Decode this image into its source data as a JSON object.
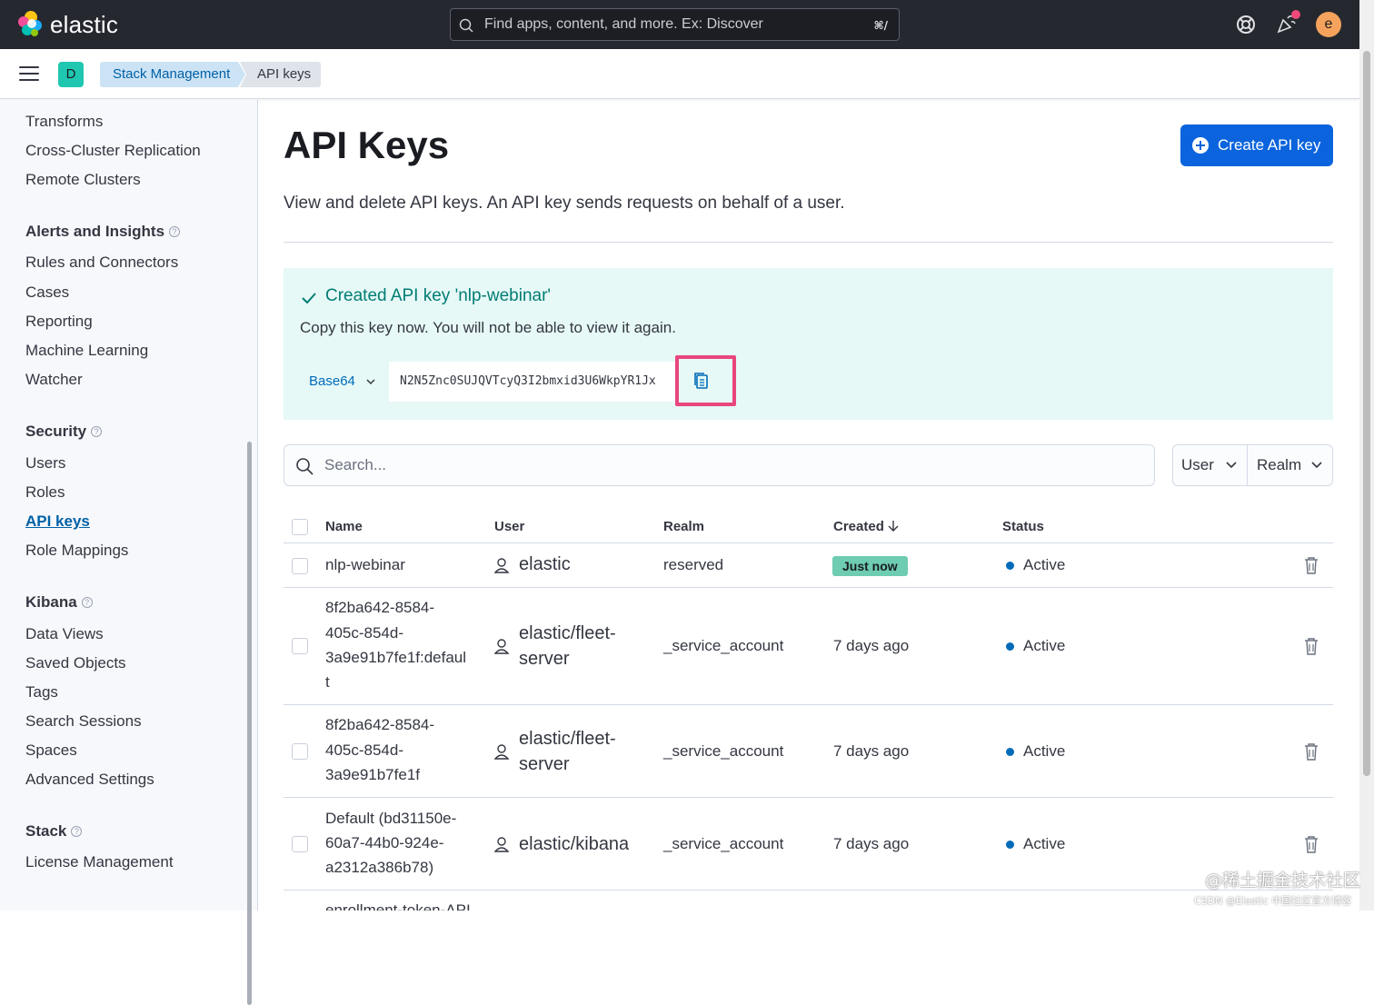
{
  "header": {
    "brand": "elastic",
    "search_placeholder": "Find apps, content, and more. Ex: Discover",
    "search_shortcut": "⌘/",
    "avatar_initial": "e"
  },
  "subbar": {
    "space_initial": "D",
    "breadcrumbs": [
      "Stack Management",
      "API keys"
    ]
  },
  "sidebar": {
    "top_items": [
      "Transforms",
      "Cross-Cluster Replication",
      "Remote Clusters"
    ],
    "groups": [
      {
        "title": "Alerts and Insights",
        "items": [
          "Rules and Connectors",
          "Cases",
          "Reporting",
          "Machine Learning",
          "Watcher"
        ]
      },
      {
        "title": "Security",
        "items": [
          "Users",
          "Roles",
          "API keys",
          "Role Mappings"
        ]
      },
      {
        "title": "Kibana",
        "items": [
          "Data Views",
          "Saved Objects",
          "Tags",
          "Search Sessions",
          "Spaces",
          "Advanced Settings"
        ]
      },
      {
        "title": "Stack",
        "items": [
          "License Management"
        ]
      }
    ],
    "active_item": "API keys"
  },
  "main": {
    "title": "API Keys",
    "create_button": "Create API key",
    "description": "View and delete API keys. An API key sends requests on behalf of a user.",
    "callout": {
      "title": "Created API key 'nlp-webinar'",
      "body": "Copy this key now. You will not be able to view it again.",
      "format": "Base64",
      "key": "N2N5Znc0SUJQVTcyQ3I2bmxid3U6WkpYR1Jx"
    },
    "search_placeholder": "Search...",
    "filters": [
      "User",
      "Realm"
    ],
    "columns": [
      "Name",
      "User",
      "Realm",
      "Created",
      "Status"
    ],
    "rows": [
      {
        "name": [
          "nlp-webinar"
        ],
        "user": [
          "elastic"
        ],
        "realm": "reserved",
        "created": "Just now",
        "created_badge": true,
        "status": "Active"
      },
      {
        "name": [
          "8f2ba642-8584-",
          "405c-854d-",
          "3a9e91b7fe1f:defaul",
          "t"
        ],
        "user": [
          "elastic/fleet-",
          "server"
        ],
        "realm": "_service_account",
        "created": "7 days ago",
        "created_badge": false,
        "status": "Active"
      },
      {
        "name": [
          "8f2ba642-8584-",
          "405c-854d-",
          "3a9e91b7fe1f"
        ],
        "user": [
          "elastic/fleet-",
          "server"
        ],
        "realm": "_service_account",
        "created": "7 days ago",
        "created_badge": false,
        "status": "Active"
      },
      {
        "name": [
          "Default (bd31150e-",
          "60a7-44b0-924e-",
          "a2312a386b78)"
        ],
        "user": [
          "elastic/kibana"
        ],
        "realm": "_service_account",
        "created": "7 days ago",
        "created_badge": false,
        "status": "Active"
      },
      {
        "name": [
          "enrollment-token-API"
        ],
        "user": [],
        "realm": "",
        "created": "",
        "created_badge": false,
        "status": ""
      }
    ]
  },
  "watermark": {
    "line1": "@稀土掘金技术社区",
    "line2": "CSDN @Elastic 中国社区官方博客"
  },
  "colors": {
    "header_bg": "#25282f",
    "primary": "#0b64dd",
    "success_bg": "#e6f9f7",
    "success_text": "#017d73",
    "highlight": "#e8467c",
    "badge_new": "#6dccb1",
    "status_active": "#006bb8"
  }
}
